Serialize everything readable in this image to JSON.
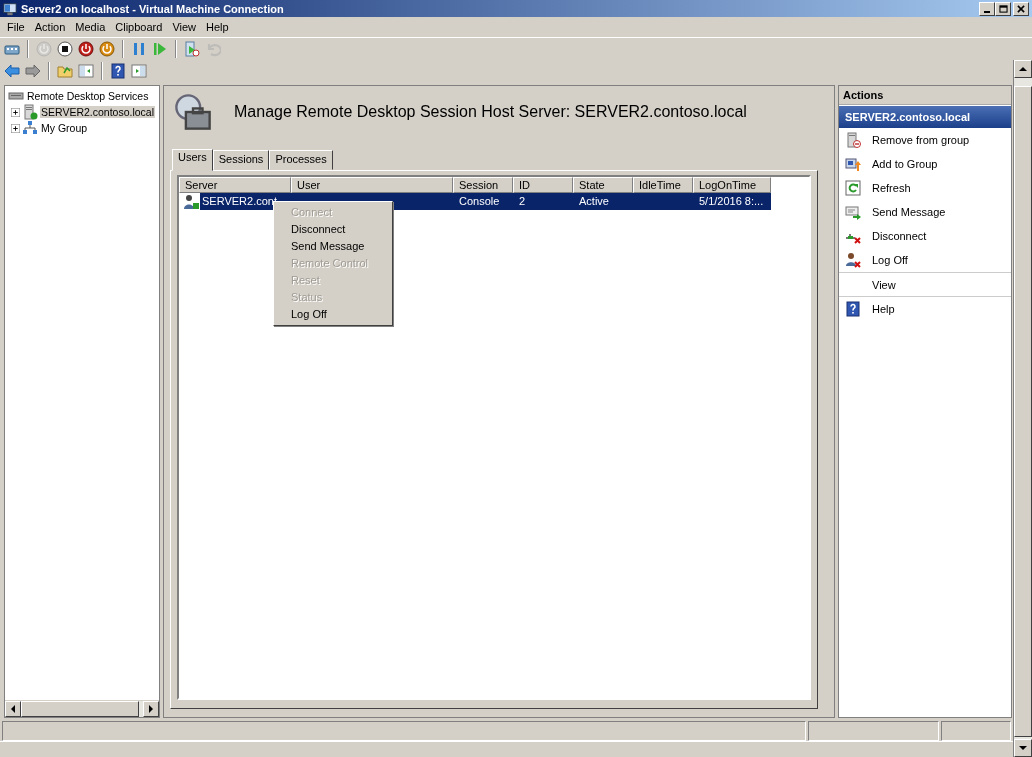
{
  "window": {
    "title": "Server2 on localhost - Virtual Machine Connection"
  },
  "menu": [
    "File",
    "Action",
    "Media",
    "Clipboard",
    "View",
    "Help"
  ],
  "vm_toolbar": [
    {
      "kind": "keys",
      "disabled": false
    },
    {
      "kind": "sep"
    },
    {
      "kind": "start",
      "disabled": true
    },
    {
      "kind": "turnoff",
      "disabled": false
    },
    {
      "kind": "shutdown",
      "disabled": false
    },
    {
      "kind": "save",
      "disabled": false
    },
    {
      "kind": "sep"
    },
    {
      "kind": "pause",
      "disabled": false
    },
    {
      "kind": "resume",
      "disabled": false
    },
    {
      "kind": "sep"
    },
    {
      "kind": "snapshot",
      "disabled": false
    },
    {
      "kind": "revert",
      "disabled": true
    }
  ],
  "mmc_toolbar": [
    {
      "kind": "back",
      "disabled": false
    },
    {
      "kind": "forward",
      "disabled": false
    },
    {
      "kind": "sep"
    },
    {
      "kind": "up",
      "disabled": false
    },
    {
      "kind": "tree",
      "disabled": false
    },
    {
      "kind": "sep"
    },
    {
      "kind": "help",
      "disabled": false
    },
    {
      "kind": "pane",
      "disabled": false
    }
  ],
  "tree": [
    {
      "label": "Remote Desktop Services",
      "selected": false,
      "children": [
        {
          "label": "SERVER2.contoso.local",
          "selected": true,
          "kind": "server"
        },
        {
          "label": "My Group",
          "selected": false,
          "kind": "group"
        }
      ]
    }
  ],
  "header": {
    "title": "Manage Remote Desktop Session Host Server: SERVER2.contoso.local"
  },
  "tabs": [
    {
      "label": "Users",
      "selected": true
    },
    {
      "label": "Sessions",
      "selected": false
    },
    {
      "label": "Processes",
      "selected": false
    }
  ],
  "table": {
    "columns": [
      "Server",
      "User",
      "Session",
      "ID",
      "State",
      "IdleTime",
      "LogOnTime"
    ],
    "rows": [
      {
        "selected": true,
        "cells": [
          "SERVER2.cont",
          null,
          "Console",
          "2",
          "Active",
          null,
          "5/1/2016 8:..."
        ]
      }
    ]
  },
  "context_menu": [
    {
      "label": "Connect",
      "disabled": true
    },
    {
      "label": "Disconnect",
      "disabled": false
    },
    {
      "label": "Send Message",
      "disabled": false
    },
    {
      "label": "Remote Control",
      "disabled": true
    },
    {
      "label": "Reset",
      "disabled": true
    },
    {
      "label": "Status",
      "disabled": true
    },
    {
      "label": "Log Off",
      "disabled": false
    }
  ],
  "actions": {
    "title": "Actions",
    "group": "SERVER2.contoso.local",
    "items": [
      {
        "label": "Remove from group",
        "kind": "remove"
      },
      {
        "label": "Add to Group",
        "kind": "add"
      },
      {
        "label": "Refresh",
        "kind": "refresh"
      },
      {
        "label": "Send Message",
        "kind": "message"
      },
      {
        "label": "Disconnect",
        "kind": "disconnect"
      },
      {
        "label": "Log Off",
        "kind": "logoff"
      },
      {
        "label": "View",
        "kind": "view"
      },
      {
        "label": "Help",
        "kind": "help"
      }
    ]
  }
}
